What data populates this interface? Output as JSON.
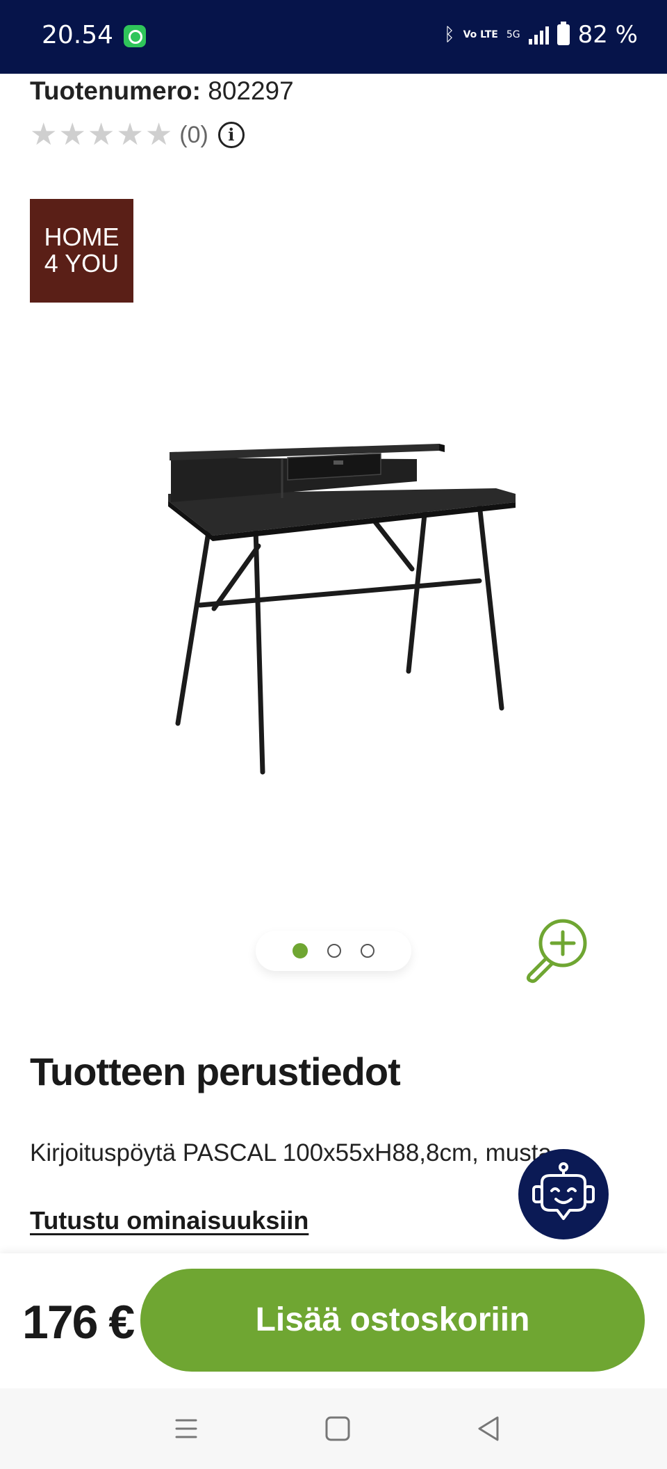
{
  "status_bar": {
    "time": "20.54",
    "network": "5G",
    "volte": "Vo LTE",
    "battery": "82 %"
  },
  "product": {
    "number_label": "Tuotenumero:",
    "number_value": "802297",
    "rating_stars": 0,
    "rating_max": 5,
    "rating_count": "(0)",
    "brand_line1": "HOME",
    "brand_line2": "4 YOU",
    "image_count": 3,
    "image_active_index": 0
  },
  "details": {
    "title": "Tuotteen perustiedot",
    "description": "Kirjoituspöytä PASCAL 100x55xH88,8cm, musta",
    "features_link": "Tutustu ominaisuuksiin"
  },
  "purchase": {
    "price": "176 €",
    "add_to_cart": "Lisää ostoskoriin"
  },
  "icons": {
    "info": "info-icon",
    "zoom": "zoom-in-icon",
    "assistant": "chat-bot-icon"
  },
  "colors": {
    "status_bar": "#06144a",
    "accent_green": "#6fa632",
    "brand_bg": "#5a1f17",
    "bot_bg": "#0b1a55"
  }
}
